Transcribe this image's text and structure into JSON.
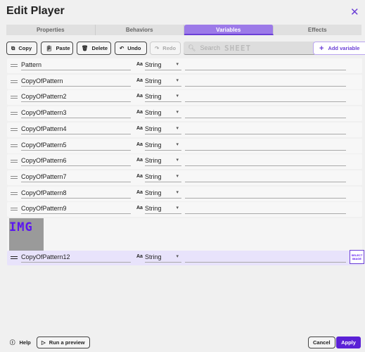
{
  "title": "Edit Player",
  "tabs": [
    "Properties",
    "Behaviors",
    "Variables",
    "Effects"
  ],
  "active_tab": "Variables",
  "toolbar": {
    "copy": "Copy",
    "paste": "Paste",
    "delete": "Delete",
    "undo": "Undo",
    "redo": "Redo",
    "search_placeholder": "Search",
    "search_watermark": "SHEET",
    "add_variable": "Add variable"
  },
  "variables": [
    {
      "name": "Pattern",
      "type": "String",
      "value": ""
    },
    {
      "name": "CopyOfPattern",
      "type": "String",
      "value": ""
    },
    {
      "name": "CopyOfPattern2",
      "type": "String",
      "value": ""
    },
    {
      "name": "CopyOfPattern3",
      "type": "String",
      "value": ""
    },
    {
      "name": "CopyOfPattern4",
      "type": "String",
      "value": ""
    },
    {
      "name": "CopyOfPattern5",
      "type": "String",
      "value": ""
    },
    {
      "name": "CopyOfPattern6",
      "type": "String",
      "value": ""
    },
    {
      "name": "CopyOfPattern7",
      "type": "String",
      "value": ""
    },
    {
      "name": "CopyOfPattern8",
      "type": "String",
      "value": ""
    },
    {
      "name": "CopyOfPattern9",
      "type": "String",
      "value": ""
    }
  ],
  "image_placeholder": "IMG",
  "selected_variable": {
    "name": "CopyOfPattern12",
    "type": "String",
    "value": ""
  },
  "type_icon": "Aa",
  "select_image": "SELECT IMAGE",
  "footer": {
    "help": "Help",
    "run_preview": "Run a preview",
    "cancel": "Cancel",
    "apply": "Apply"
  },
  "colors": {
    "accent": "#6b3fd6",
    "apply": "#5b21d6",
    "active_tab": "#9c7ae8"
  }
}
